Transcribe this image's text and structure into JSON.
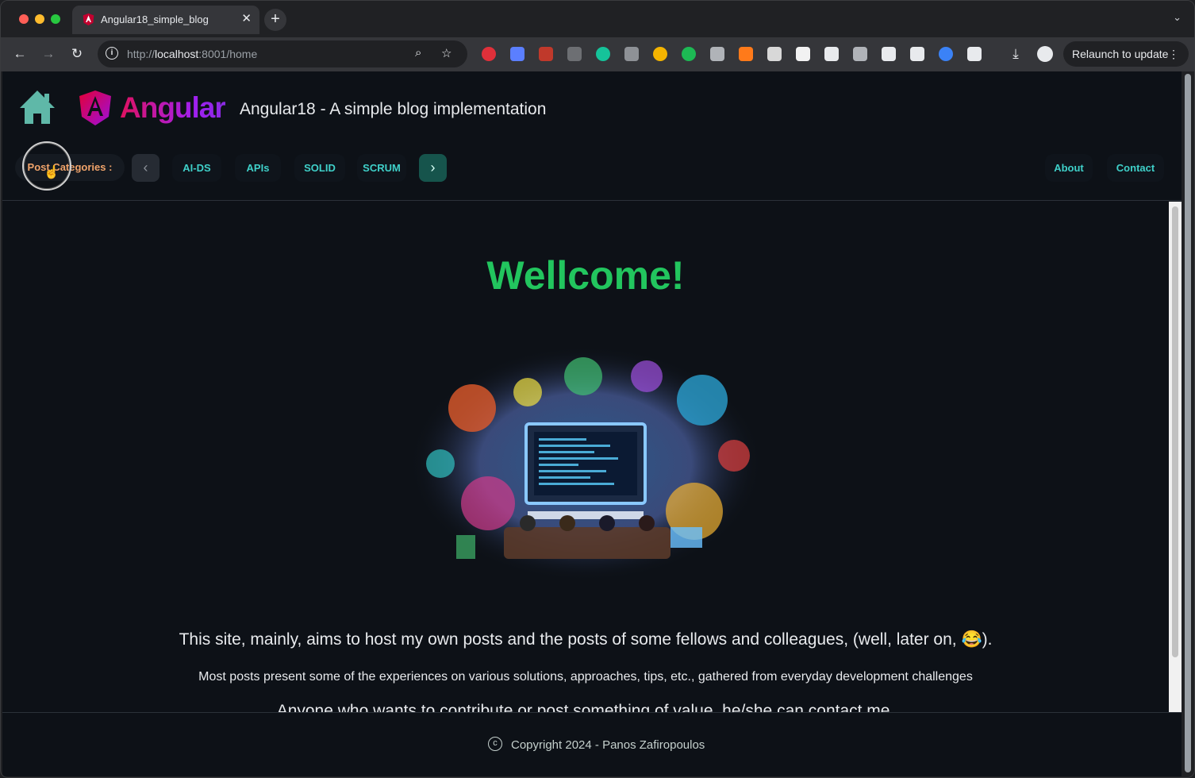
{
  "browser": {
    "tab_title": "Angular18_simple_blog",
    "tab_close": "✕",
    "new_tab": "+",
    "url_scheme": "http://",
    "url_host": "localhost",
    "url_rest": ":8001/home",
    "relaunch_label": "Relaunch to update",
    "relaunch_dots": "⋮",
    "tabs_menu": "⌄",
    "extensions": [
      {
        "name": "adblock-plus-icon",
        "color": "#e0303a"
      },
      {
        "name": "extension-square-icon",
        "color": "#5b7fff"
      },
      {
        "name": "extension-pdf-icon",
        "color": "#c0392b"
      },
      {
        "name": "extension-arrow-icon",
        "color": "#6d6f73"
      },
      {
        "name": "grammarly-icon",
        "color": "#15c39a"
      },
      {
        "name": "extension-circle-icon",
        "color": "#8e9196"
      },
      {
        "name": "color-picker-icon",
        "color": "#f4b400"
      },
      {
        "name": "extension-green-icon",
        "color": "#1db954"
      },
      {
        "name": "extension-glasses-icon",
        "color": "#b0b3b8"
      },
      {
        "name": "extension-flame-icon",
        "color": "#ff7a1a"
      },
      {
        "name": "extension-image-icon",
        "color": "#d8d8d8"
      },
      {
        "name": "medium-icon",
        "color": "#f2f2f2"
      },
      {
        "name": "markdown-icon",
        "color": "#e8eaed"
      },
      {
        "name": "extension-window-icon",
        "color": "#b0b3b8"
      },
      {
        "name": "extension-cat-icon",
        "color": "#e8eaed"
      },
      {
        "name": "extension-moon-icon",
        "color": "#e8eaed"
      },
      {
        "name": "extension-blue-icon",
        "color": "#3b82f6"
      },
      {
        "name": "puzzle-extensions-icon",
        "color": "#e8eaed"
      }
    ]
  },
  "header": {
    "logo_text": "Angular",
    "title": "Angular18 - A simple blog implementation",
    "categories_label": "Post Categories :",
    "prev_glyph": "‹",
    "next_glyph": "›",
    "categories": [
      "AI-DS",
      "APIs",
      "SOLID",
      "SCRUM"
    ],
    "links": [
      "About",
      "Contact"
    ]
  },
  "main": {
    "heading": "Wellcome!",
    "intro_line1": "This site, mainly, aims to host my own posts and the posts of some fellows and colleagues, (well, later on, 😂).",
    "intro_line2": "Most posts present some of the experiences on various solutions, approaches, tips, etc., gathered from everyday development challenges",
    "intro_line3": "Anyone who wants to contribute or post something of value, he/she can contact me."
  },
  "footer": {
    "copyright_symbol": "c",
    "text": "Copyright 2024 - Panos Zafiropoulos"
  },
  "colors": {
    "accent_teal": "#3fd0c9",
    "welcome_green": "#22c55e",
    "category_orange": "#f0a36a",
    "page_bg": "#0d1117"
  }
}
